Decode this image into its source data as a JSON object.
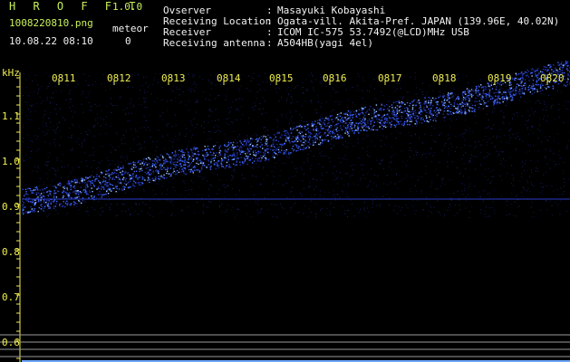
{
  "header": {
    "app_title": "H R O F F T",
    "app_version": "1.0.0",
    "file_name": "1008220810.png",
    "timestamp": "10.08.22 08:10",
    "meteor_label": "meteor",
    "meteor_count": "0"
  },
  "meta": [
    {
      "key": "Ovserver",
      "value": "Masayuki Kobayashi"
    },
    {
      "key": "Receiving Location",
      "value": "Ogata-vill. Akita-Pref. JAPAN (139.96E, 40.02N)"
    },
    {
      "key": "Receiver",
      "value": "ICOM IC-575 53.7492(@LCD)MHz USB"
    },
    {
      "key": "Receiving antenna",
      "value": "A504HB(yagi 4el)"
    }
  ],
  "axis": {
    "unit": "kHz",
    "frequency_ticks": [
      "1.1",
      "1.0",
      "0.9",
      "0.8",
      "0.7",
      "0.6"
    ],
    "time_labels": [
      "0811",
      "0812",
      "0813",
      "0814",
      "0815",
      "0816",
      "0817",
      "0818",
      "0819",
      "0820"
    ]
  },
  "colors": {
    "background": "#000000",
    "signal": "#3c64ff",
    "label_yellow": "#f0ee50",
    "title_green": "#c8f05a"
  }
}
